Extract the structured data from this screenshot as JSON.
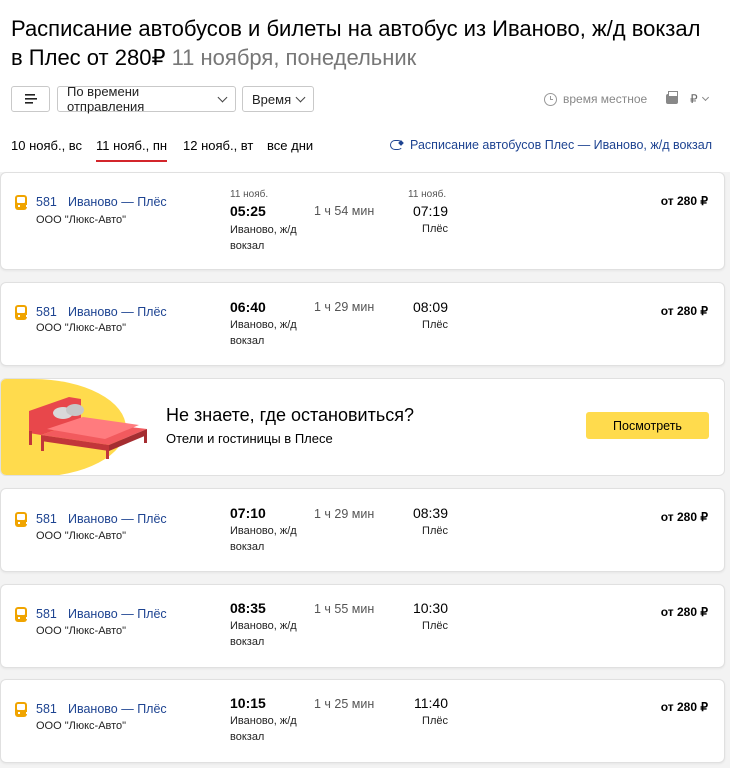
{
  "header": {
    "title": "Расписание автобусов и билеты на автобус из Иваново, ж/д вокзал в Плес от 280₽",
    "date": "11 ноября, понедельник"
  },
  "toolbar": {
    "sort_label": "По времени отправления",
    "time_label": "Время",
    "timezone_label": "время местное",
    "currency": "₽"
  },
  "tabs": [
    {
      "label": "10 нояб., вс"
    },
    {
      "label": "11 нояб., пн"
    },
    {
      "label": "12 нояб., вт"
    },
    {
      "label": "все дни"
    }
  ],
  "route_link": "Расписание автобусов Плес — Иваново, ж/д вокзал",
  "trips": [
    {
      "route_number": "581",
      "route_name": "Иваново — Плёс",
      "carrier": "ООО \"Люкс-Авто\"",
      "dep_date": "11 нояб.",
      "dep_time": "05:25",
      "dep_place": "Иваново, ж/д вокзал",
      "duration": "1 ч 54 мин",
      "arr_date": "11 нояб.",
      "arr_time": "07:19",
      "arr_place": "Плёс",
      "price": "от 280 ₽"
    },
    {
      "route_number": "581",
      "route_name": "Иваново — Плёс",
      "carrier": "ООО \"Люкс-Авто\"",
      "dep_time": "06:40",
      "dep_place": "Иваново, ж/д вокзал",
      "duration": "1 ч 29 мин",
      "arr_time": "08:09",
      "arr_place": "Плёс",
      "price": "от 280 ₽"
    },
    {
      "route_number": "581",
      "route_name": "Иваново — Плёс",
      "carrier": "ООО \"Люкс-Авто\"",
      "dep_time": "07:10",
      "dep_place": "Иваново, ж/д вокзал",
      "duration": "1 ч 29 мин",
      "arr_time": "08:39",
      "arr_place": "Плёс",
      "price": "от 280 ₽"
    },
    {
      "route_number": "581",
      "route_name": "Иваново — Плёс",
      "carrier": "ООО \"Люкс-Авто\"",
      "dep_time": "08:35",
      "dep_place": "Иваново, ж/д вокзал",
      "duration": "1 ч 55 мин",
      "arr_time": "10:30",
      "arr_place": "Плёс",
      "price": "от 280 ₽"
    },
    {
      "route_number": "581",
      "route_name": "Иваново — Плёс",
      "carrier": "ООО \"Люкс-Авто\"",
      "dep_time": "10:15",
      "dep_place": "Иваново, ж/д вокзал",
      "duration": "1 ч 25 мин",
      "arr_time": "11:40",
      "arr_place": "Плёс",
      "price": "от 280 ₽"
    }
  ],
  "ad": {
    "title": "Не знаете, где остановиться?",
    "subtitle": "Отели и гостиницы в Плесе",
    "button": "Посмотреть"
  },
  "icons": {
    "menu": "hamburger-icon",
    "clock": "clock-icon",
    "print": "printer-icon",
    "route": "swap-icon",
    "bus": "bus-icon"
  },
  "colors": {
    "link": "#1d4391",
    "tab_underline": "#d3252b",
    "bus_icon": "#f0a400",
    "ad_accent": "#ffdb4d"
  }
}
